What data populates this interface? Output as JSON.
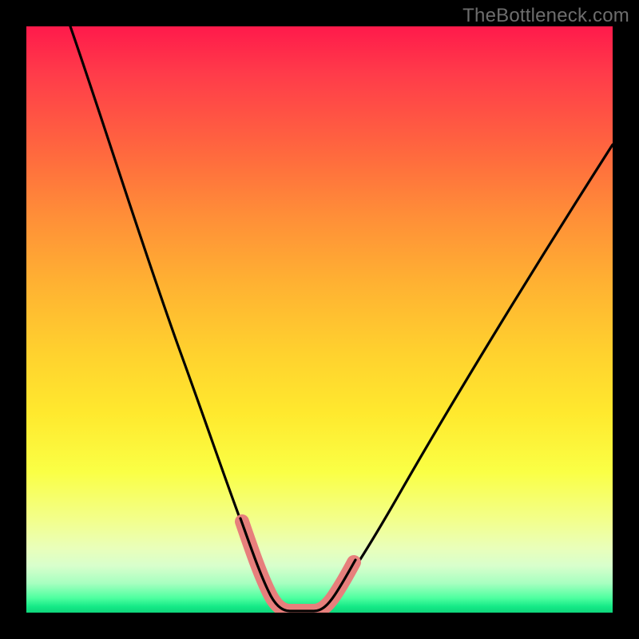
{
  "watermark": "TheBottleneck.com",
  "colors": {
    "page_bg": "#000000",
    "curve": "#000000",
    "trough_marker": "#e77f7c",
    "gradient_top": "#ff1a4b",
    "gradient_bottom": "#0fd57b"
  },
  "chart_data": {
    "type": "line",
    "title": "",
    "xlabel": "",
    "ylabel": "",
    "xlim": [
      0,
      100
    ],
    "ylim": [
      0,
      100
    ],
    "note": "V-shaped bottleneck chart on a rainbow gradient. Series values represent curve height (0 = bottom/green, 100 = top/red) sampled at even x positions. The trough_marker identifies the flat minimum band highlighted in pink.",
    "series": [
      {
        "name": "bottleneck-curve",
        "x": [
          0,
          5,
          10,
          15,
          20,
          25,
          30,
          35,
          37,
          40,
          42,
          44,
          46,
          48,
          50,
          55,
          60,
          65,
          70,
          75,
          80,
          85,
          90,
          95,
          100
        ],
        "values": [
          100,
          89,
          78,
          67,
          56,
          45,
          33,
          19,
          11,
          3,
          0,
          0,
          0,
          0,
          2,
          9,
          16,
          24,
          32,
          40,
          48,
          56,
          64,
          72,
          80
        ]
      }
    ],
    "trough_marker": {
      "x_start": 37,
      "x_end": 50,
      "y_start": 11,
      "y_end": 2
    }
  }
}
